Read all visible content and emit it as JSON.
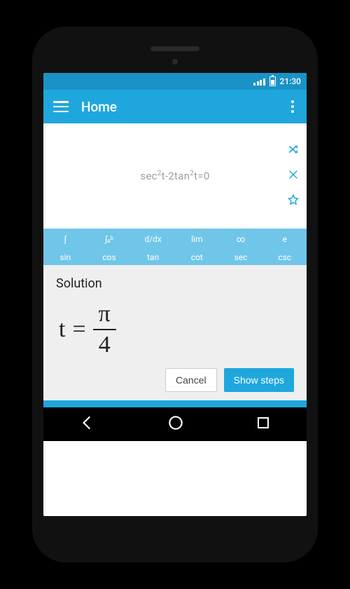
{
  "status": {
    "time": "21:30"
  },
  "appbar": {
    "title": "Home"
  },
  "expression": {
    "parts": [
      "sec",
      "2",
      "t-2tan",
      "2",
      "t=0"
    ]
  },
  "keyboard": {
    "row1": [
      "∫",
      "∫ₐᵇ",
      "d/dx",
      "lim",
      "∞",
      "e"
    ],
    "row2": [
      "sin",
      "cos",
      "tan",
      "cot",
      "sec",
      "csc"
    ]
  },
  "solution": {
    "heading": "Solution",
    "lhs": "t",
    "eq": "=",
    "numerator": "π",
    "denominator": "4"
  },
  "buttons": {
    "cancel": "Cancel",
    "primary": "Show steps"
  }
}
